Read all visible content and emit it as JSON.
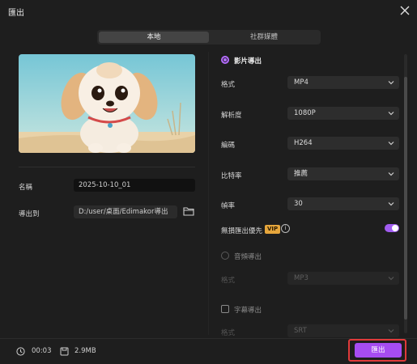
{
  "window": {
    "title": "匯出"
  },
  "tabs": [
    {
      "label": "本地",
      "active": true
    },
    {
      "label": "社群媒體",
      "active": false
    }
  ],
  "left": {
    "name_label": "名稱",
    "name_value": "2025-10-10_01",
    "export_to_label": "導出到",
    "export_to_value": "D:/user/桌面/Edimakor導出"
  },
  "video_export": {
    "heading": "影片導出",
    "format_label": "格式",
    "format_value": "MP4",
    "resolution_label": "解析度",
    "resolution_value": "1080P",
    "encoding_label": "編碼",
    "encoding_value": "H264",
    "bitrate_label": "比特率",
    "bitrate_value": "推薦",
    "framerate_label": "幀率",
    "framerate_value": "30",
    "lossless_label": "無損匯出優先",
    "vip_badge": "VIP",
    "lossless_enabled": true
  },
  "audio_export": {
    "heading": "音頻導出",
    "format_label": "格式",
    "format_value": "MP3"
  },
  "subtitle_export": {
    "heading": "字幕導出",
    "format_label": "格式",
    "format_value": "SRT"
  },
  "footer": {
    "duration": "00:03",
    "size": "2.9MB",
    "export_label": "匯出"
  },
  "colors": {
    "accent": "#a64cf2",
    "highlight": "#e03a3a",
    "vip": "#e6a63c"
  }
}
